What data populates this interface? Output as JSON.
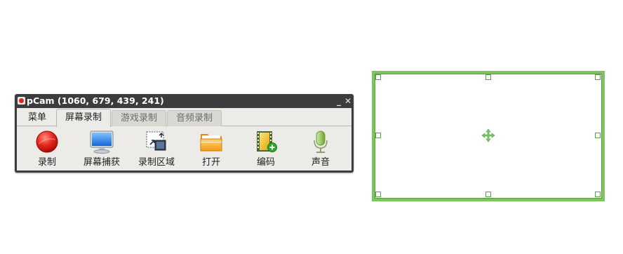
{
  "window": {
    "title": "pCam (1060, 679, 439, 241)",
    "minimize_symbol": "_",
    "close_symbol": "✕"
  },
  "tabs": [
    {
      "label": "菜单",
      "state": "menu"
    },
    {
      "label": "屏幕录制",
      "state": "active"
    },
    {
      "label": "游戏录制",
      "state": "inactive"
    },
    {
      "label": "音频录制",
      "state": "inactive"
    }
  ],
  "toolbar": [
    {
      "label": "录制",
      "icon": "record-icon"
    },
    {
      "label": "屏幕捕获",
      "icon": "monitor-icon"
    },
    {
      "label": "录制区域",
      "icon": "region-icon"
    },
    {
      "label": "打开",
      "icon": "folder-icon"
    },
    {
      "label": "编码",
      "icon": "film-add-icon"
    },
    {
      "label": "声音",
      "icon": "microphone-icon"
    }
  ],
  "selection": {
    "border_color": "#7cc560",
    "handle_color": "#55a33a",
    "center_icon": "move-icon"
  }
}
